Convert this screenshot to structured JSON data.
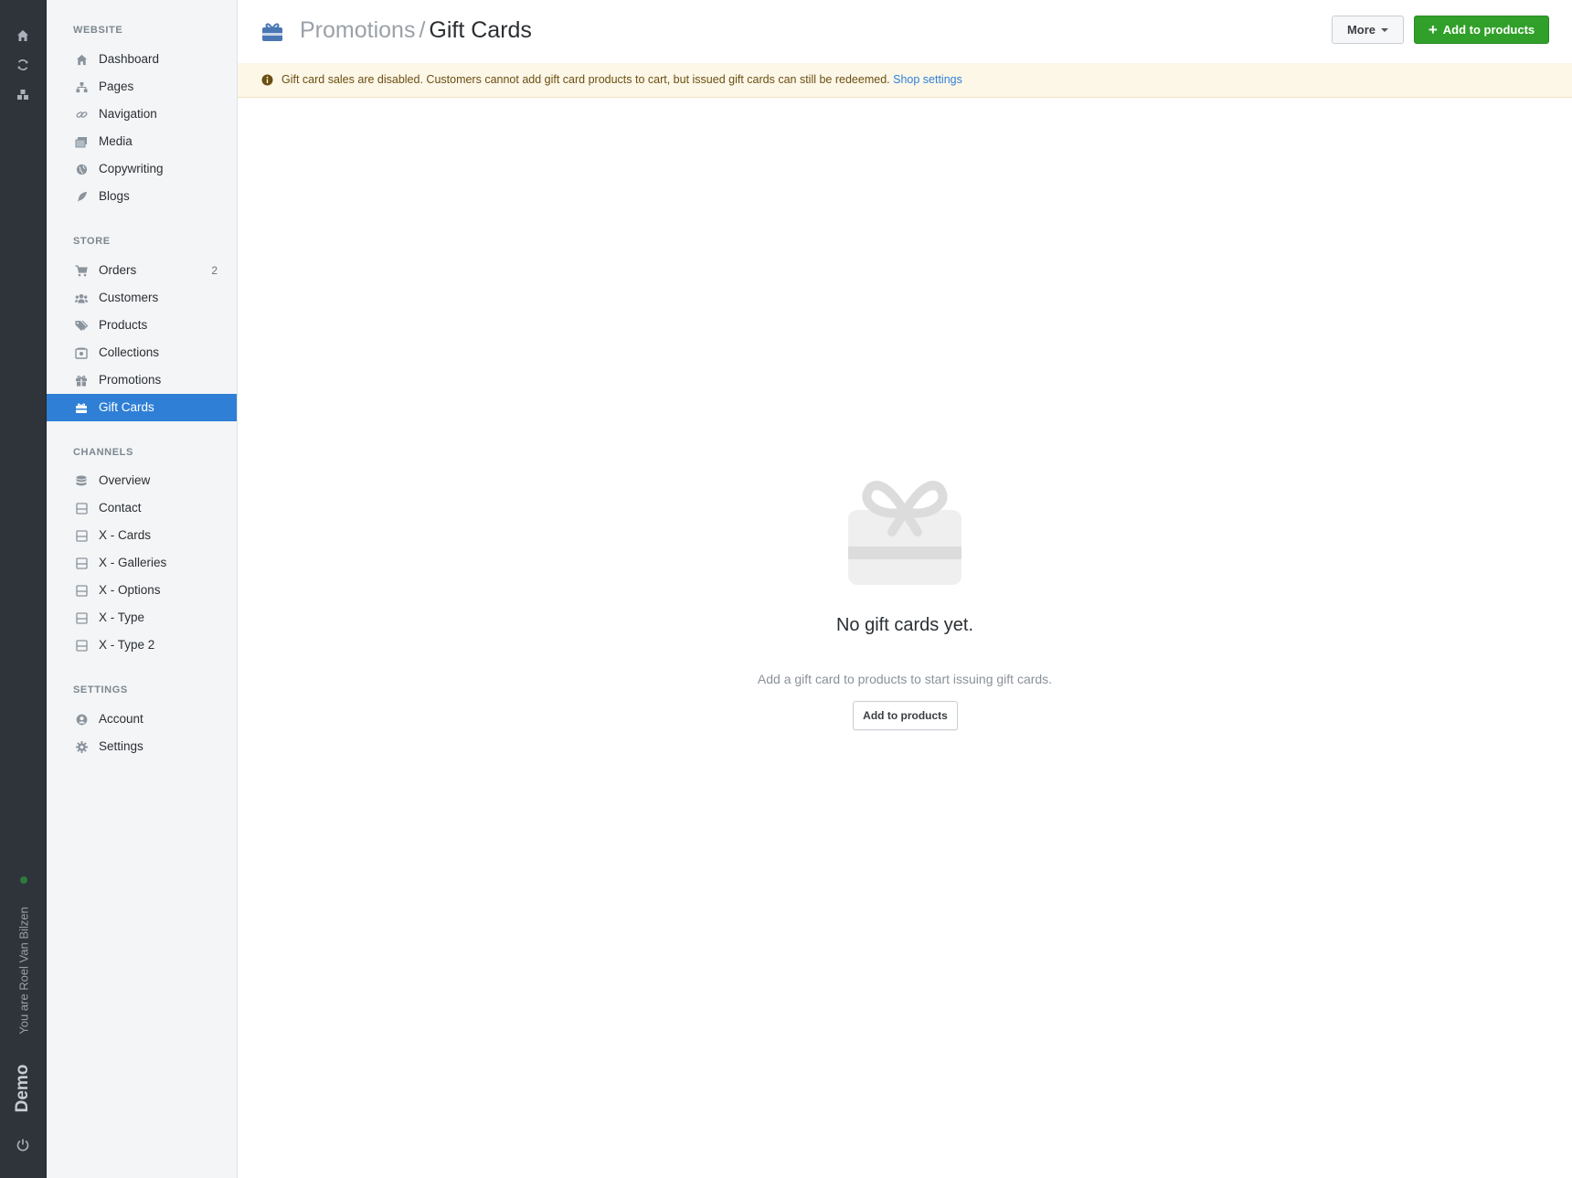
{
  "rail": {
    "icons": [
      "home-icon",
      "refresh-icon",
      "cubes-icon"
    ],
    "user_text": "You are Roel Van Bilzen",
    "workspace": "Demo",
    "power_icon": "power-icon"
  },
  "sidebar": {
    "sections": [
      {
        "title": "WEBSITE",
        "items": [
          {
            "label": "Dashboard",
            "icon": "home-icon"
          },
          {
            "label": "Pages",
            "icon": "sitemap-icon"
          },
          {
            "label": "Navigation",
            "icon": "link-icon"
          },
          {
            "label": "Media",
            "icon": "images-icon"
          },
          {
            "label": "Copywriting",
            "icon": "globe-icon"
          },
          {
            "label": "Blogs",
            "icon": "feather-icon"
          }
        ]
      },
      {
        "title": "STORE",
        "items": [
          {
            "label": "Orders",
            "icon": "cart-icon",
            "count": "2"
          },
          {
            "label": "Customers",
            "icon": "users-icon"
          },
          {
            "label": "Products",
            "icon": "tags-icon"
          },
          {
            "label": "Collections",
            "icon": "collection-icon"
          },
          {
            "label": "Promotions",
            "icon": "gift-icon"
          },
          {
            "label": "Gift Cards",
            "icon": "gift-card-icon",
            "active": true
          }
        ]
      },
      {
        "title": "CHANNELS",
        "items": [
          {
            "label": "Overview",
            "icon": "database-icon"
          },
          {
            "label": "Contact",
            "icon": "box-icon"
          },
          {
            "label": "X - Cards",
            "icon": "box-icon"
          },
          {
            "label": "X - Galleries",
            "icon": "box-icon"
          },
          {
            "label": "X - Options",
            "icon": "box-icon"
          },
          {
            "label": "X - Type",
            "icon": "box-icon"
          },
          {
            "label": "X - Type 2",
            "icon": "box-icon"
          }
        ]
      },
      {
        "title": "SETTINGS",
        "items": [
          {
            "label": "Account",
            "icon": "user-circle-icon"
          },
          {
            "label": "Settings",
            "icon": "gear-icon"
          }
        ]
      }
    ]
  },
  "header": {
    "breadcrumb_parent": "Promotions",
    "breadcrumb_sep": "/",
    "title": "Gift Cards",
    "more_label": "More",
    "add_label": "Add to products"
  },
  "alert": {
    "text": "Gift card sales are disabled. Customers cannot add gift card products to cart, but issued gift cards can still be redeemed.",
    "link": "Shop settings"
  },
  "empty": {
    "title": "No gift cards yet.",
    "subtitle": "Add a gift card to products to start issuing gift cards.",
    "button": "Add to products"
  },
  "colors": {
    "accent": "#2f7fd6",
    "success": "#31a02a",
    "warning_bg": "#fdf7e8"
  }
}
